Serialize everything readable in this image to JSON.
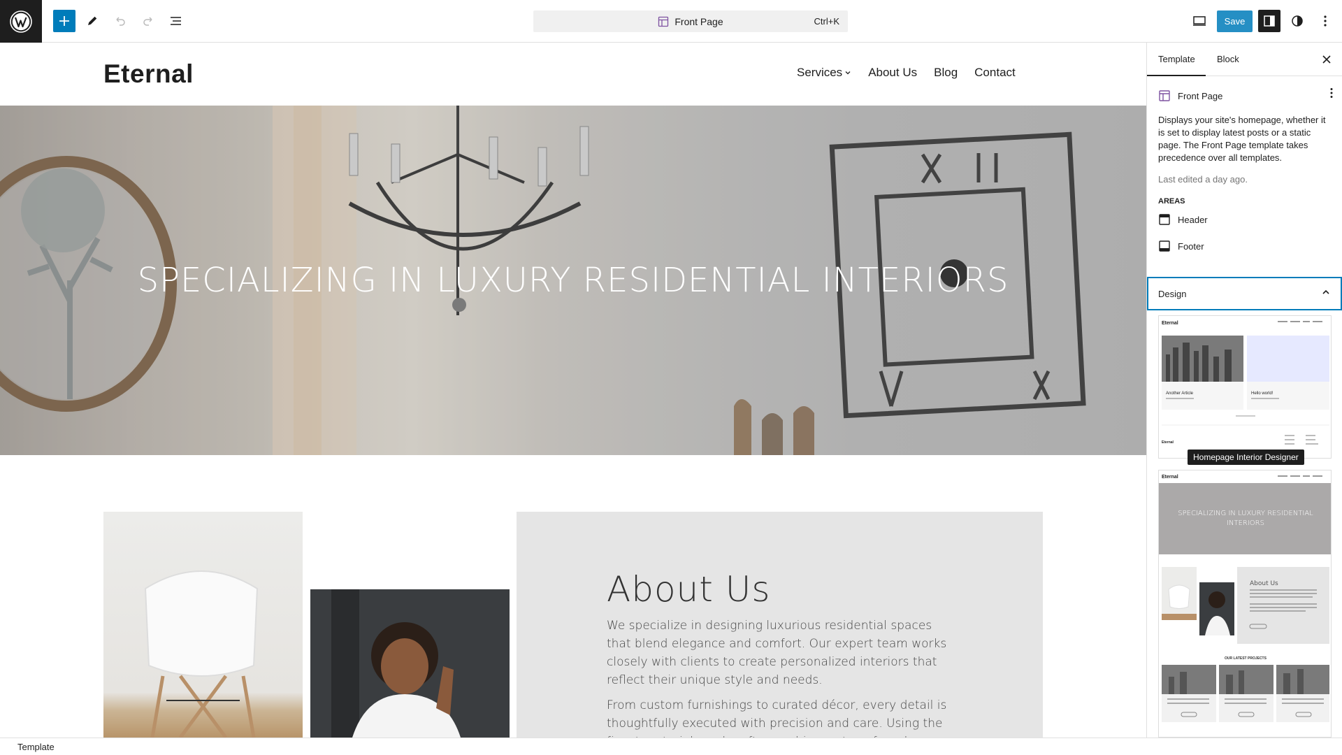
{
  "topbar": {
    "command_title": "Front Page",
    "command_shortcut": "Ctrl+K",
    "save_label": "Save",
    "icons": [
      "wordpress-logo",
      "plus-icon",
      "pencil-icon",
      "undo-icon",
      "redo-icon",
      "list-view-icon",
      "desktop-preview-icon",
      "settings-sidebar-icon",
      "styles-half-circle-icon",
      "more-vertical-icon"
    ]
  },
  "canvas": {
    "site_title": "Eternal",
    "nav": [
      "Services",
      "About Us",
      "Blog",
      "Contact"
    ],
    "hero_title": "SPECIALIZING IN LUXURY RESIDENTIAL INTERIORS",
    "about_heading": "About Us",
    "about_p1": "We specialize in designing luxurious residential spaces that blend elegance and comfort. Our expert team works closely with clients to create personalized interiors that reflect their unique style and needs.",
    "about_p2": "From custom furnishings to curated décor, every detail is thoughtfully executed with precision and care. Using the finest materials and craftsmanship, we transform houses into"
  },
  "sidebar": {
    "tabs": [
      "Template",
      "Block"
    ],
    "template_title": "Front Page",
    "description": "Displays your site's homepage, whether it is set to display latest posts or a static page. The Front Page template takes precedence over all templates.",
    "last_edited": "Last edited a day ago.",
    "areas_label": "AREAS",
    "areas": [
      "Header",
      "Footer"
    ],
    "design_label": "Design",
    "tooltip": "Homepage Interior Designer",
    "pattern1": {
      "site_title": "Eternal",
      "post1_title": "Another Article",
      "post2_title": "Hello world!",
      "footer_title": "Eternal"
    },
    "pattern2": {
      "site_title": "Eternal",
      "hero_title": "SPECIALIZING IN LUXURY RESIDENTIAL INTERIORS",
      "about_heading": "About Us",
      "projects_label": "OUR LATEST PROJECTS"
    }
  },
  "statusbar": {
    "label": "Template"
  },
  "colors": {
    "accent": "#007cba",
    "dark": "#1e1e1e",
    "purple": "#7e52a1"
  }
}
